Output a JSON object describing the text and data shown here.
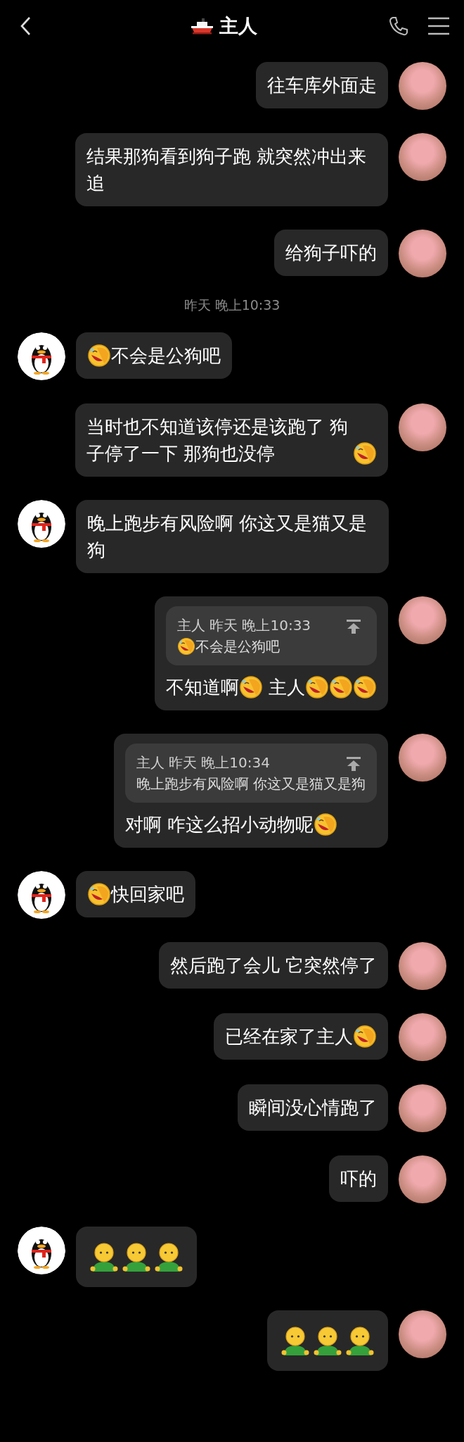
{
  "header": {
    "title": "主人"
  },
  "messages": [
    {
      "kind": "message",
      "from_me": true,
      "parts": [
        {
          "kind": "text",
          "text": "往车库外面走"
        }
      ]
    },
    {
      "kind": "message",
      "from_me": true,
      "parts": [
        {
          "kind": "text",
          "text": "结果那狗看到狗子跑 就突然冲出来追"
        }
      ]
    },
    {
      "kind": "message",
      "from_me": true,
      "parts": [
        {
          "kind": "text",
          "text": "给狗子吓的"
        }
      ]
    },
    {
      "kind": "timestamp",
      "text": "昨天 晚上10:33"
    },
    {
      "kind": "message",
      "from_me": false,
      "parts": [
        {
          "kind": "laugh-emoji"
        },
        {
          "kind": "text",
          "text": "不会是公狗吧"
        }
      ]
    },
    {
      "kind": "message",
      "from_me": true,
      "parts": [
        {
          "kind": "text",
          "text": "当时也不知道该停还是该跑了 狗子停了一下 那狗也没停"
        },
        {
          "kind": "laugh-emoji"
        }
      ]
    },
    {
      "kind": "message",
      "from_me": false,
      "parts": [
        {
          "kind": "text",
          "text": "晚上跑步有风险啊 你这又是猫又是狗"
        }
      ]
    },
    {
      "kind": "message",
      "from_me": true,
      "quote": {
        "header": "主人 昨天 晚上10:33",
        "parts": [
          {
            "kind": "laugh-emoji"
          },
          {
            "kind": "text",
            "text": "不会是公狗吧"
          }
        ]
      },
      "parts": [
        {
          "kind": "text",
          "text": "不知道啊"
        },
        {
          "kind": "laugh-emoji"
        },
        {
          "kind": "text",
          "text": " 主人"
        },
        {
          "kind": "laugh-emoji"
        },
        {
          "kind": "laugh-emoji"
        },
        {
          "kind": "laugh-emoji"
        }
      ]
    },
    {
      "kind": "message",
      "from_me": true,
      "quote": {
        "header": "主人 昨天 晚上10:34",
        "parts": [
          {
            "kind": "text",
            "text": "晚上跑步有风险啊 你这又是猫又是狗"
          }
        ]
      },
      "parts": [
        {
          "kind": "text",
          "text": "对啊 咋这么招小动物呢"
        },
        {
          "kind": "laugh-emoji"
        }
      ]
    },
    {
      "kind": "message",
      "from_me": false,
      "parts": [
        {
          "kind": "laugh-emoji"
        },
        {
          "kind": "text",
          "text": "快回家吧"
        }
      ]
    },
    {
      "kind": "message",
      "from_me": true,
      "parts": [
        {
          "kind": "text",
          "text": "然后跑了会儿 它突然停了"
        }
      ]
    },
    {
      "kind": "message",
      "from_me": true,
      "parts": [
        {
          "kind": "text",
          "text": "已经在家了主人"
        },
        {
          "kind": "laugh-emoji"
        }
      ]
    },
    {
      "kind": "message",
      "from_me": true,
      "parts": [
        {
          "kind": "text",
          "text": "瞬间没心情跑了"
        }
      ]
    },
    {
      "kind": "message",
      "from_me": true,
      "parts": [
        {
          "kind": "text",
          "text": "吓的"
        }
      ]
    },
    {
      "kind": "message",
      "from_me": false,
      "parts": [
        {
          "kind": "person-emoji"
        },
        {
          "kind": "person-emoji"
        },
        {
          "kind": "person-emoji"
        }
      ]
    },
    {
      "kind": "message",
      "from_me": true,
      "parts": [
        {
          "kind": "person-emoji"
        },
        {
          "kind": "person-emoji"
        },
        {
          "kind": "person-emoji"
        }
      ]
    }
  ]
}
